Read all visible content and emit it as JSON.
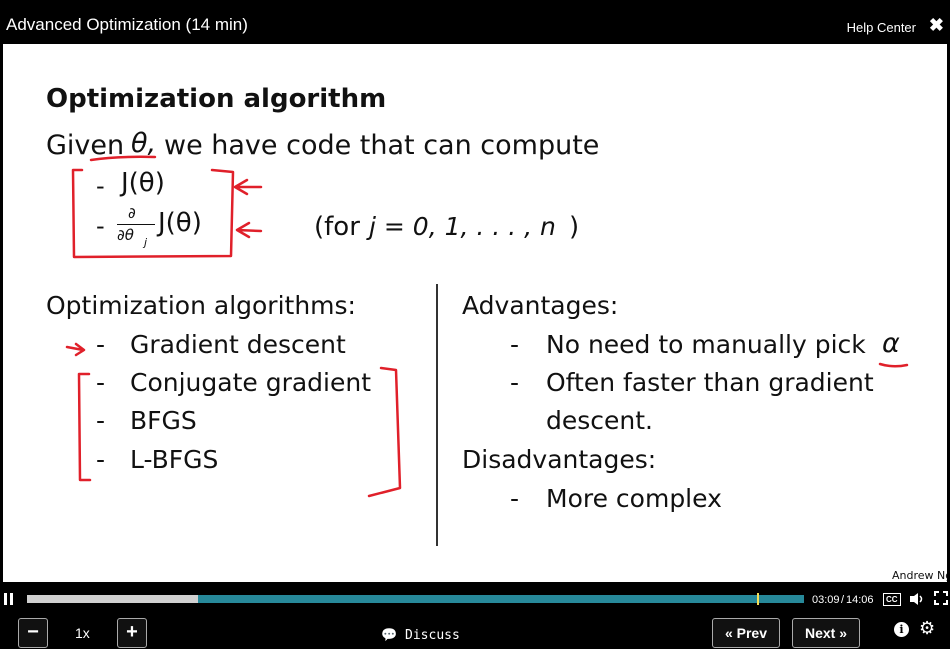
{
  "header": {
    "title": "Advanced Optimization (14 min)",
    "help_label": "Help Center",
    "close_icon": "close-icon"
  },
  "slide": {
    "heading": "Optimization algorithm",
    "given_prefix": "Given",
    "theta": "θ,",
    "given_suffix": "we have code that can compute",
    "bullet_dash": "-",
    "cost_fn": "J(θ)",
    "partial_num": "∂",
    "partial_den": "∂θ",
    "partial_sub": "j",
    "for_text": "(for",
    "for_math": "j = 0, 1, . . . , n",
    "for_close": ")",
    "algos_heading": "Optimization algorithms:",
    "algos": [
      "Gradient descent",
      "Conjugate gradient",
      "BFGS",
      "L-BFGS"
    ],
    "adv_heading": "Advantages:",
    "adv_items": [
      "No need to manually pick",
      "Often faster than gradient",
      "descent."
    ],
    "alpha": "α",
    "disadv_heading": "Disadvantages:",
    "disadv_items": [
      "More complex"
    ],
    "author": "Andrew Ng"
  },
  "player": {
    "speed": "1x",
    "discuss_label": "Discuss",
    "prev_label": "« Prev",
    "next_label": "Next »",
    "current_time": "03:09",
    "total_time": "14:06",
    "progress": 0.22,
    "marker": 0.94,
    "cc_label": "CC",
    "colors": {
      "progress_track": "#27899a",
      "progress_played": "#d0d0d0",
      "marker": "#f5e05a",
      "annotation": "#e0202a"
    }
  }
}
